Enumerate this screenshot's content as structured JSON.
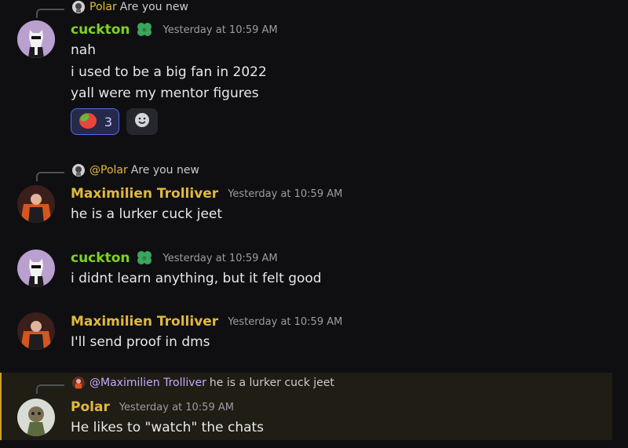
{
  "messages": [
    {
      "reply": {
        "author": "Polar",
        "text": "Are you new"
      },
      "author": "cuckton",
      "timestamp": "Yesterday at 10:59 AM",
      "lines": [
        "nah",
        "i used to be a big fan in 2022",
        "yall were my mentor figures"
      ],
      "reaction": {
        "emoji": "tomato-emoji",
        "count": "3"
      },
      "add_reaction_icon": "smiley-icon"
    },
    {
      "reply": {
        "author": "@Polar",
        "text": "Are you new"
      },
      "author": "Maximilien Trolliver",
      "timestamp": "Yesterday at 10:59 AM",
      "lines": [
        "he is a lurker cuck jeet"
      ]
    },
    {
      "author": "cuckton",
      "timestamp": "Yesterday at 10:59 AM",
      "lines": [
        "i didnt learn anything, but it felt good"
      ]
    },
    {
      "author": "Maximilien Trolliver",
      "timestamp": "Yesterday at 10:59 AM",
      "lines": [
        "I'll send proof in dms"
      ]
    },
    {
      "reply": {
        "author": "@Maximilien Trolliver",
        "text": "he is a lurker cuck jeet"
      },
      "author": "Polar",
      "timestamp": "Yesterday at 10:59 AM",
      "lines": [
        "He likes to \"watch\" the chats"
      ]
    }
  ],
  "colors": {
    "background": "#0f0f12",
    "cuckton_name": "#7ed321",
    "maximilien_name": "#e2b93b",
    "polar_name": "#e2b93b",
    "highlight_bg": "#1f1d14",
    "highlight_border": "#c9a227"
  },
  "badge_icon": "clover-icon"
}
